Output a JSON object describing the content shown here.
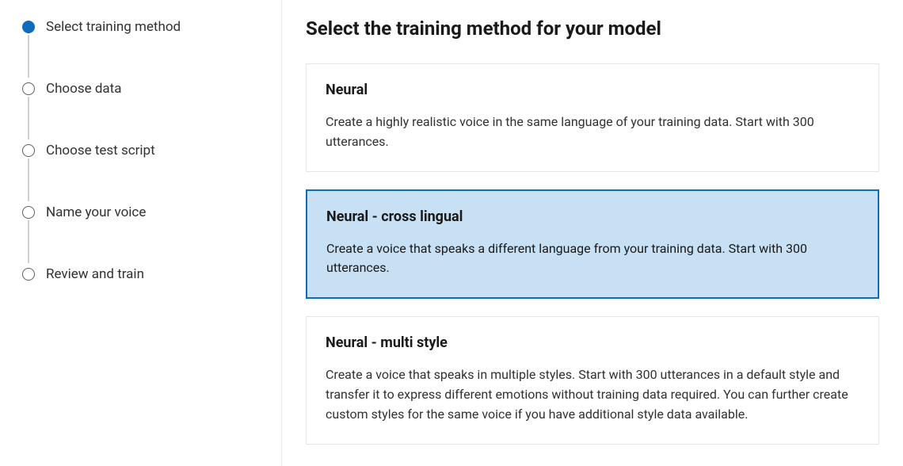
{
  "sidebar": {
    "steps": [
      {
        "label": "Select training method",
        "state": "current"
      },
      {
        "label": "Choose data",
        "state": "upcoming"
      },
      {
        "label": "Choose test script",
        "state": "upcoming"
      },
      {
        "label": "Name your voice",
        "state": "upcoming"
      },
      {
        "label": "Review and train",
        "state": "upcoming"
      }
    ]
  },
  "main": {
    "title": "Select the training method for your model",
    "options": [
      {
        "title": "Neural",
        "desc": "Create a highly realistic voice in the same language of your training data. Start with 300 utterances.",
        "selected": false
      },
      {
        "title": "Neural - cross lingual",
        "desc": "Create a voice that speaks a different language from your training data. Start with 300 utterances.",
        "selected": true
      },
      {
        "title": "Neural - multi style",
        "desc": "Create a voice that speaks in multiple styles. Start with 300 utterances in a default style and transfer it to express different emotions without training data required. You can further create custom styles for the same voice if you have additional style data available.",
        "selected": false
      }
    ]
  }
}
